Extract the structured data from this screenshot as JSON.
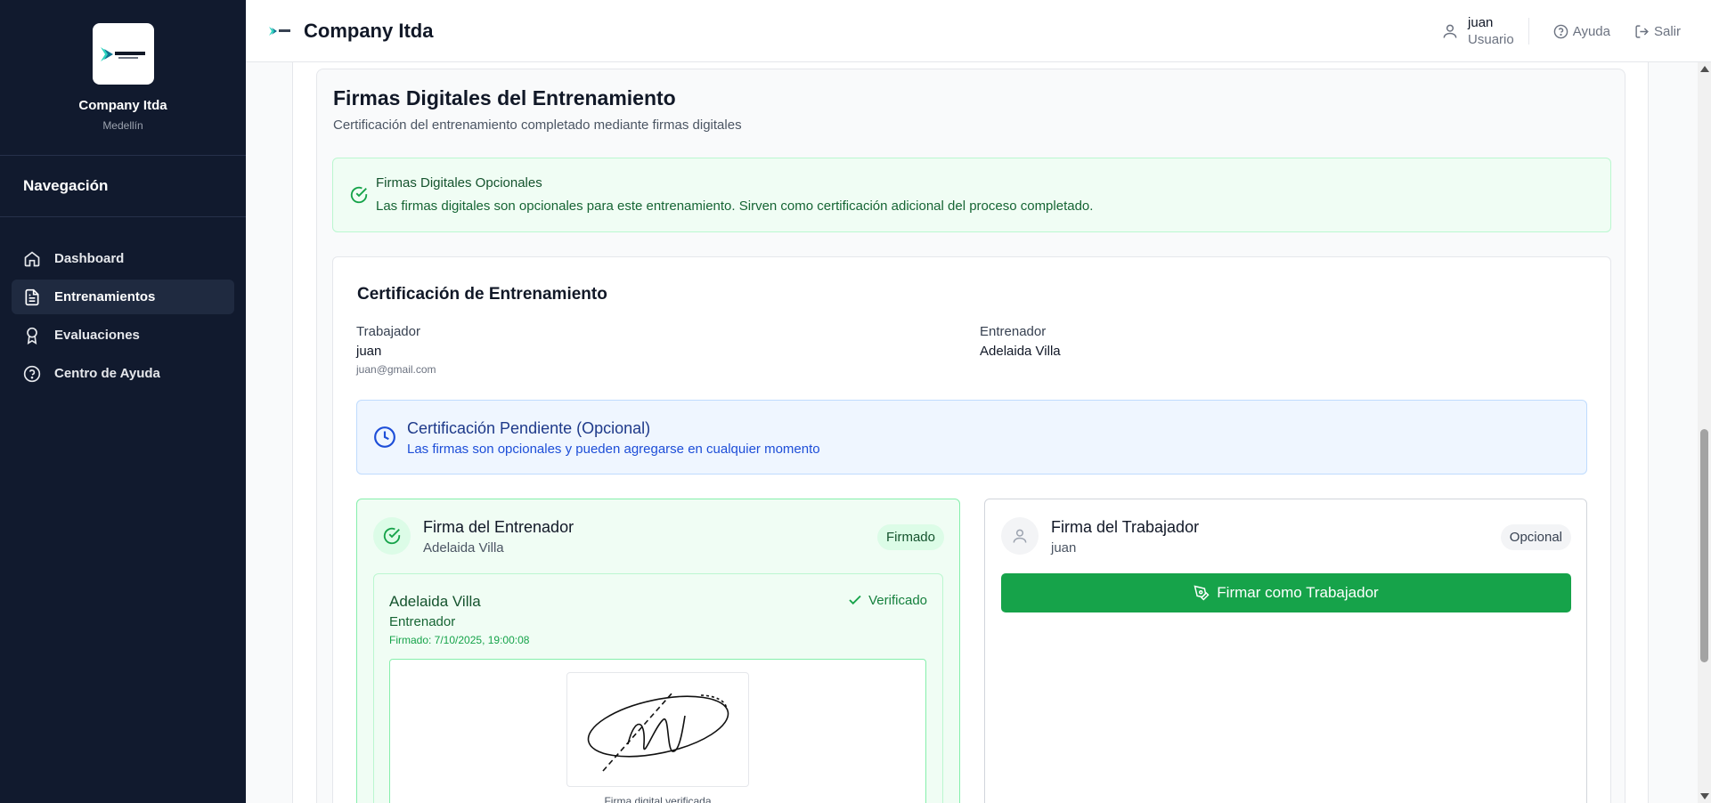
{
  "sidebar": {
    "company_name": "Company Itda",
    "city": "Medellín",
    "nav_title": "Navegación",
    "items": [
      {
        "label": "Dashboard",
        "icon": "home-icon"
      },
      {
        "label": "Entrenamientos",
        "icon": "document-icon",
        "active": true
      },
      {
        "label": "Evaluaciones",
        "icon": "award-icon"
      },
      {
        "label": "Centro de Ayuda",
        "icon": "help-circle-icon"
      }
    ]
  },
  "header": {
    "title": "Company Itda",
    "user_name": "juan",
    "user_role": "Usuario",
    "help_label": "Ayuda",
    "logout_label": "Salir"
  },
  "section": {
    "title": "Firmas Digitales del Entrenamiento",
    "subtitle": "Certificación del entrenamiento completado mediante firmas digitales",
    "optional_alert": {
      "title": "Firmas Digitales Opcionales",
      "text": "Las firmas digitales son opcionales para este entrenamiento. Sirven como certificación adicional del proceso completado."
    }
  },
  "certification": {
    "title": "Certificación de Entrenamiento",
    "worker_label": "Trabajador",
    "worker_name": "juan",
    "worker_email": "juan@gmail.com",
    "trainer_label": "Entrenador",
    "trainer_name": "Adelaida Villa",
    "pending": {
      "title": "Certificación Pendiente (Opcional)",
      "text": "Las firmas son opcionales y pueden agregarse en cualquier momento"
    }
  },
  "trainer_signature": {
    "title": "Firma del Entrenador",
    "name": "Adelaida Villa",
    "badge": "Firmado",
    "signer_name": "Adelaida Villa",
    "signer_role": "Entrenador",
    "signed_at": "Firmado: 7/10/2025, 19:00:08",
    "verified_label": "Verificado",
    "caption": "Firma digital verificada"
  },
  "worker_signature": {
    "title": "Firma del Trabajador",
    "name": "juan",
    "badge": "Opcional",
    "button_label": "Firmar como Trabajador"
  },
  "colors": {
    "sidebar_bg": "#111a2e",
    "accent_green": "#16a34a",
    "info_blue": "#1e3a8a"
  }
}
